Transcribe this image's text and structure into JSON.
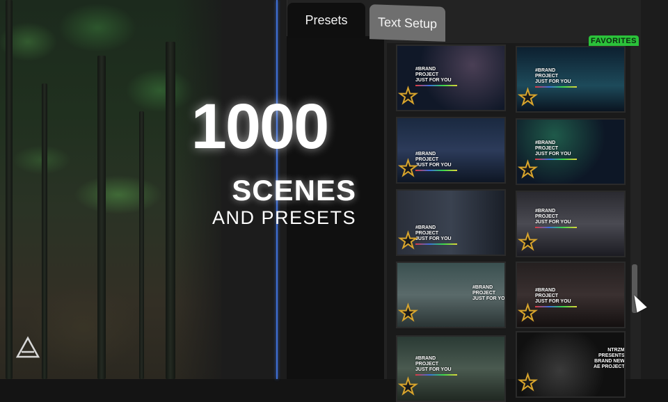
{
  "headline": {
    "number": "1000",
    "line1": "SCENES",
    "line2": "AND PRESETS"
  },
  "tabs": [
    {
      "label": "Presets",
      "active": true
    },
    {
      "label": "Text Setup",
      "active": false
    }
  ],
  "favorites_label": "FAVORITES",
  "thumbnails": [
    {
      "text": "#BRAND\nPROJECT\nJUST FOR YOU",
      "favorite_icon": "star-icon"
    },
    {
      "text": "#BRAND\nPROJECT\nJUST FOR YOU",
      "favorite_icon": "star-icon"
    },
    {
      "text": "#BRAND\nPROJECT\nJUST FOR YOU",
      "favorite_icon": "star-icon"
    },
    {
      "text": "#BRAND\nPROJECT\nJUST FOR YOU",
      "favorite_icon": "star-icon"
    },
    {
      "text": "#BRAND\nPROJECT\nJUST FOR YOU",
      "favorite_icon": "star-icon"
    },
    {
      "text": "#BRAND\nPROJECT\nJUST FOR YOU",
      "favorite_icon": "star-icon"
    },
    {
      "text": "#BRAND\nPROJECT\nJUST FOR YOU",
      "favorite_icon": "star-icon"
    },
    {
      "text": "#BRAND\nPROJECT\nJUST FOR YOU",
      "favorite_icon": "star-icon"
    },
    {
      "text": "#BRAND\nPROJECT\nJUST FOR YOU",
      "favorite_icon": "star-icon"
    },
    {
      "text": "NTRZM\nPRESENTS\nBRAND NEW\nAE PROJECT",
      "favorite_icon": "star-icon"
    }
  ],
  "colors": {
    "favorites_badge": "#2bc23a",
    "star_outline": "#d9a52c",
    "timeline_line": "#3f6fd6"
  },
  "icons": {
    "logo": "triangle-logo-icon",
    "cursor": "mouse-pointer-icon"
  }
}
